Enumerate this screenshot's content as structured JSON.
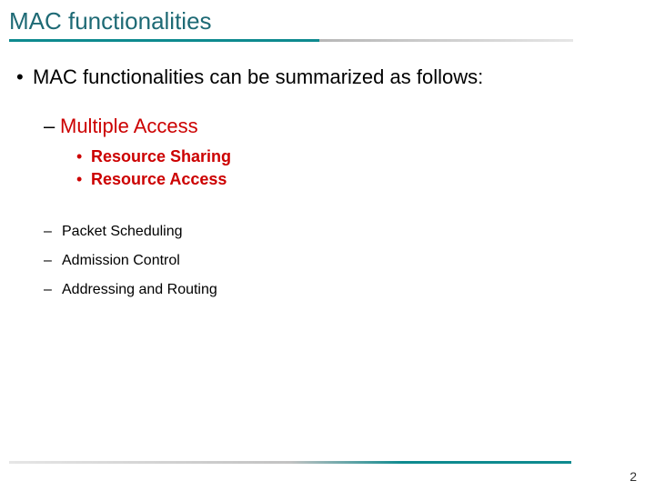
{
  "title": "MAC functionalities",
  "intro": "MAC functionalities can be summarized as follows:",
  "multiple_access": {
    "heading": "Multiple Access",
    "sub1": "Resource Sharing",
    "sub2": "Resource Access"
  },
  "items": {
    "packet_scheduling": "Packet Scheduling",
    "admission_control": "Admission Control",
    "addressing_routing": "Addressing and Routing"
  },
  "page_number": "2",
  "colors": {
    "teal": "#0e8a8f",
    "title": "#1e6a75",
    "accent": "#cc0000"
  }
}
